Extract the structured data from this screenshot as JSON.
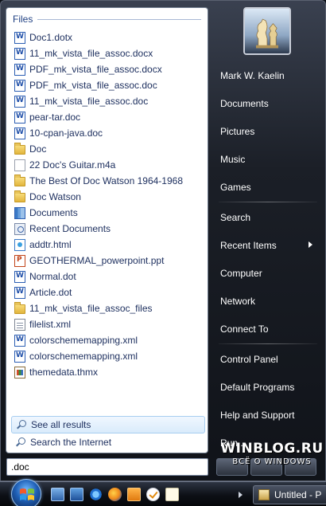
{
  "files_header": "Files",
  "files": [
    {
      "name": "Doc1.dotx",
      "icon": "word-icon",
      "kind": "word"
    },
    {
      "name": "11_mk_vista_file_assoc.docx",
      "icon": "word-icon",
      "kind": "word"
    },
    {
      "name": "PDF_mk_vista_file_assoc.docx",
      "icon": "word-icon",
      "kind": "word"
    },
    {
      "name": "PDF_mk_vista_file_assoc.doc",
      "icon": "word-icon",
      "kind": "word"
    },
    {
      "name": "11_mk_vista_file_assoc.doc",
      "icon": "word-icon",
      "kind": "word"
    },
    {
      "name": "pear-tar.doc",
      "icon": "word-icon",
      "kind": "word"
    },
    {
      "name": "10-cpan-java.doc",
      "icon": "word-icon",
      "kind": "word"
    },
    {
      "name": "Doc",
      "icon": "folder-icon",
      "kind": "folder"
    },
    {
      "name": "22 Doc's Guitar.m4a",
      "icon": "file-icon",
      "kind": "file"
    },
    {
      "name": "The Best Of Doc Watson 1964-1968",
      "icon": "folder-icon",
      "kind": "folder"
    },
    {
      "name": "Doc Watson",
      "icon": "folder-icon",
      "kind": "folder"
    },
    {
      "name": "Documents",
      "icon": "library-icon",
      "kind": "library"
    },
    {
      "name": "Recent Documents",
      "icon": "recent-icon",
      "kind": "recent"
    },
    {
      "name": "addtr.html",
      "icon": "html-icon",
      "kind": "html"
    },
    {
      "name": "GEOTHERMAL_powerpoint.ppt",
      "icon": "powerpoint-icon",
      "kind": "ppt"
    },
    {
      "name": "Normal.dot",
      "icon": "word-icon",
      "kind": "word"
    },
    {
      "name": "Article.dot",
      "icon": "word-icon",
      "kind": "word"
    },
    {
      "name": "11_mk_vista_file_assoc_files",
      "icon": "folder-icon",
      "kind": "folder"
    },
    {
      "name": "filelist.xml",
      "icon": "xml-icon",
      "kind": "xml"
    },
    {
      "name": "colorschememapping.xml",
      "icon": "word-icon",
      "kind": "word"
    },
    {
      "name": "colorschememapping.xml",
      "icon": "word-icon",
      "kind": "word"
    },
    {
      "name": "themedata.thmx",
      "icon": "theme-icon",
      "kind": "thmx"
    }
  ],
  "search_links": {
    "see_all": "See all results",
    "search_internet": "Search the Internet"
  },
  "search_box": {
    "value": ".doc"
  },
  "right_menu": {
    "user": "Mark W. Kaelin",
    "documents": "Documents",
    "pictures": "Pictures",
    "music": "Music",
    "games": "Games",
    "search": "Search",
    "recent_items": "Recent Items",
    "computer": "Computer",
    "network": "Network",
    "connect_to": "Connect To",
    "control_panel": "Control Panel",
    "default_programs": "Default Programs",
    "help_support": "Help and Support",
    "run": "Run..."
  },
  "watermark": {
    "title": "WINBLOG.RU",
    "subtitle": "ВСЁ О WINDOWS"
  },
  "taskbar": {
    "task_label": "Untitled - P"
  },
  "colors": {
    "accent": "#1e3f82",
    "hover": "#d9ebfb",
    "pane_dark": "#101319"
  }
}
